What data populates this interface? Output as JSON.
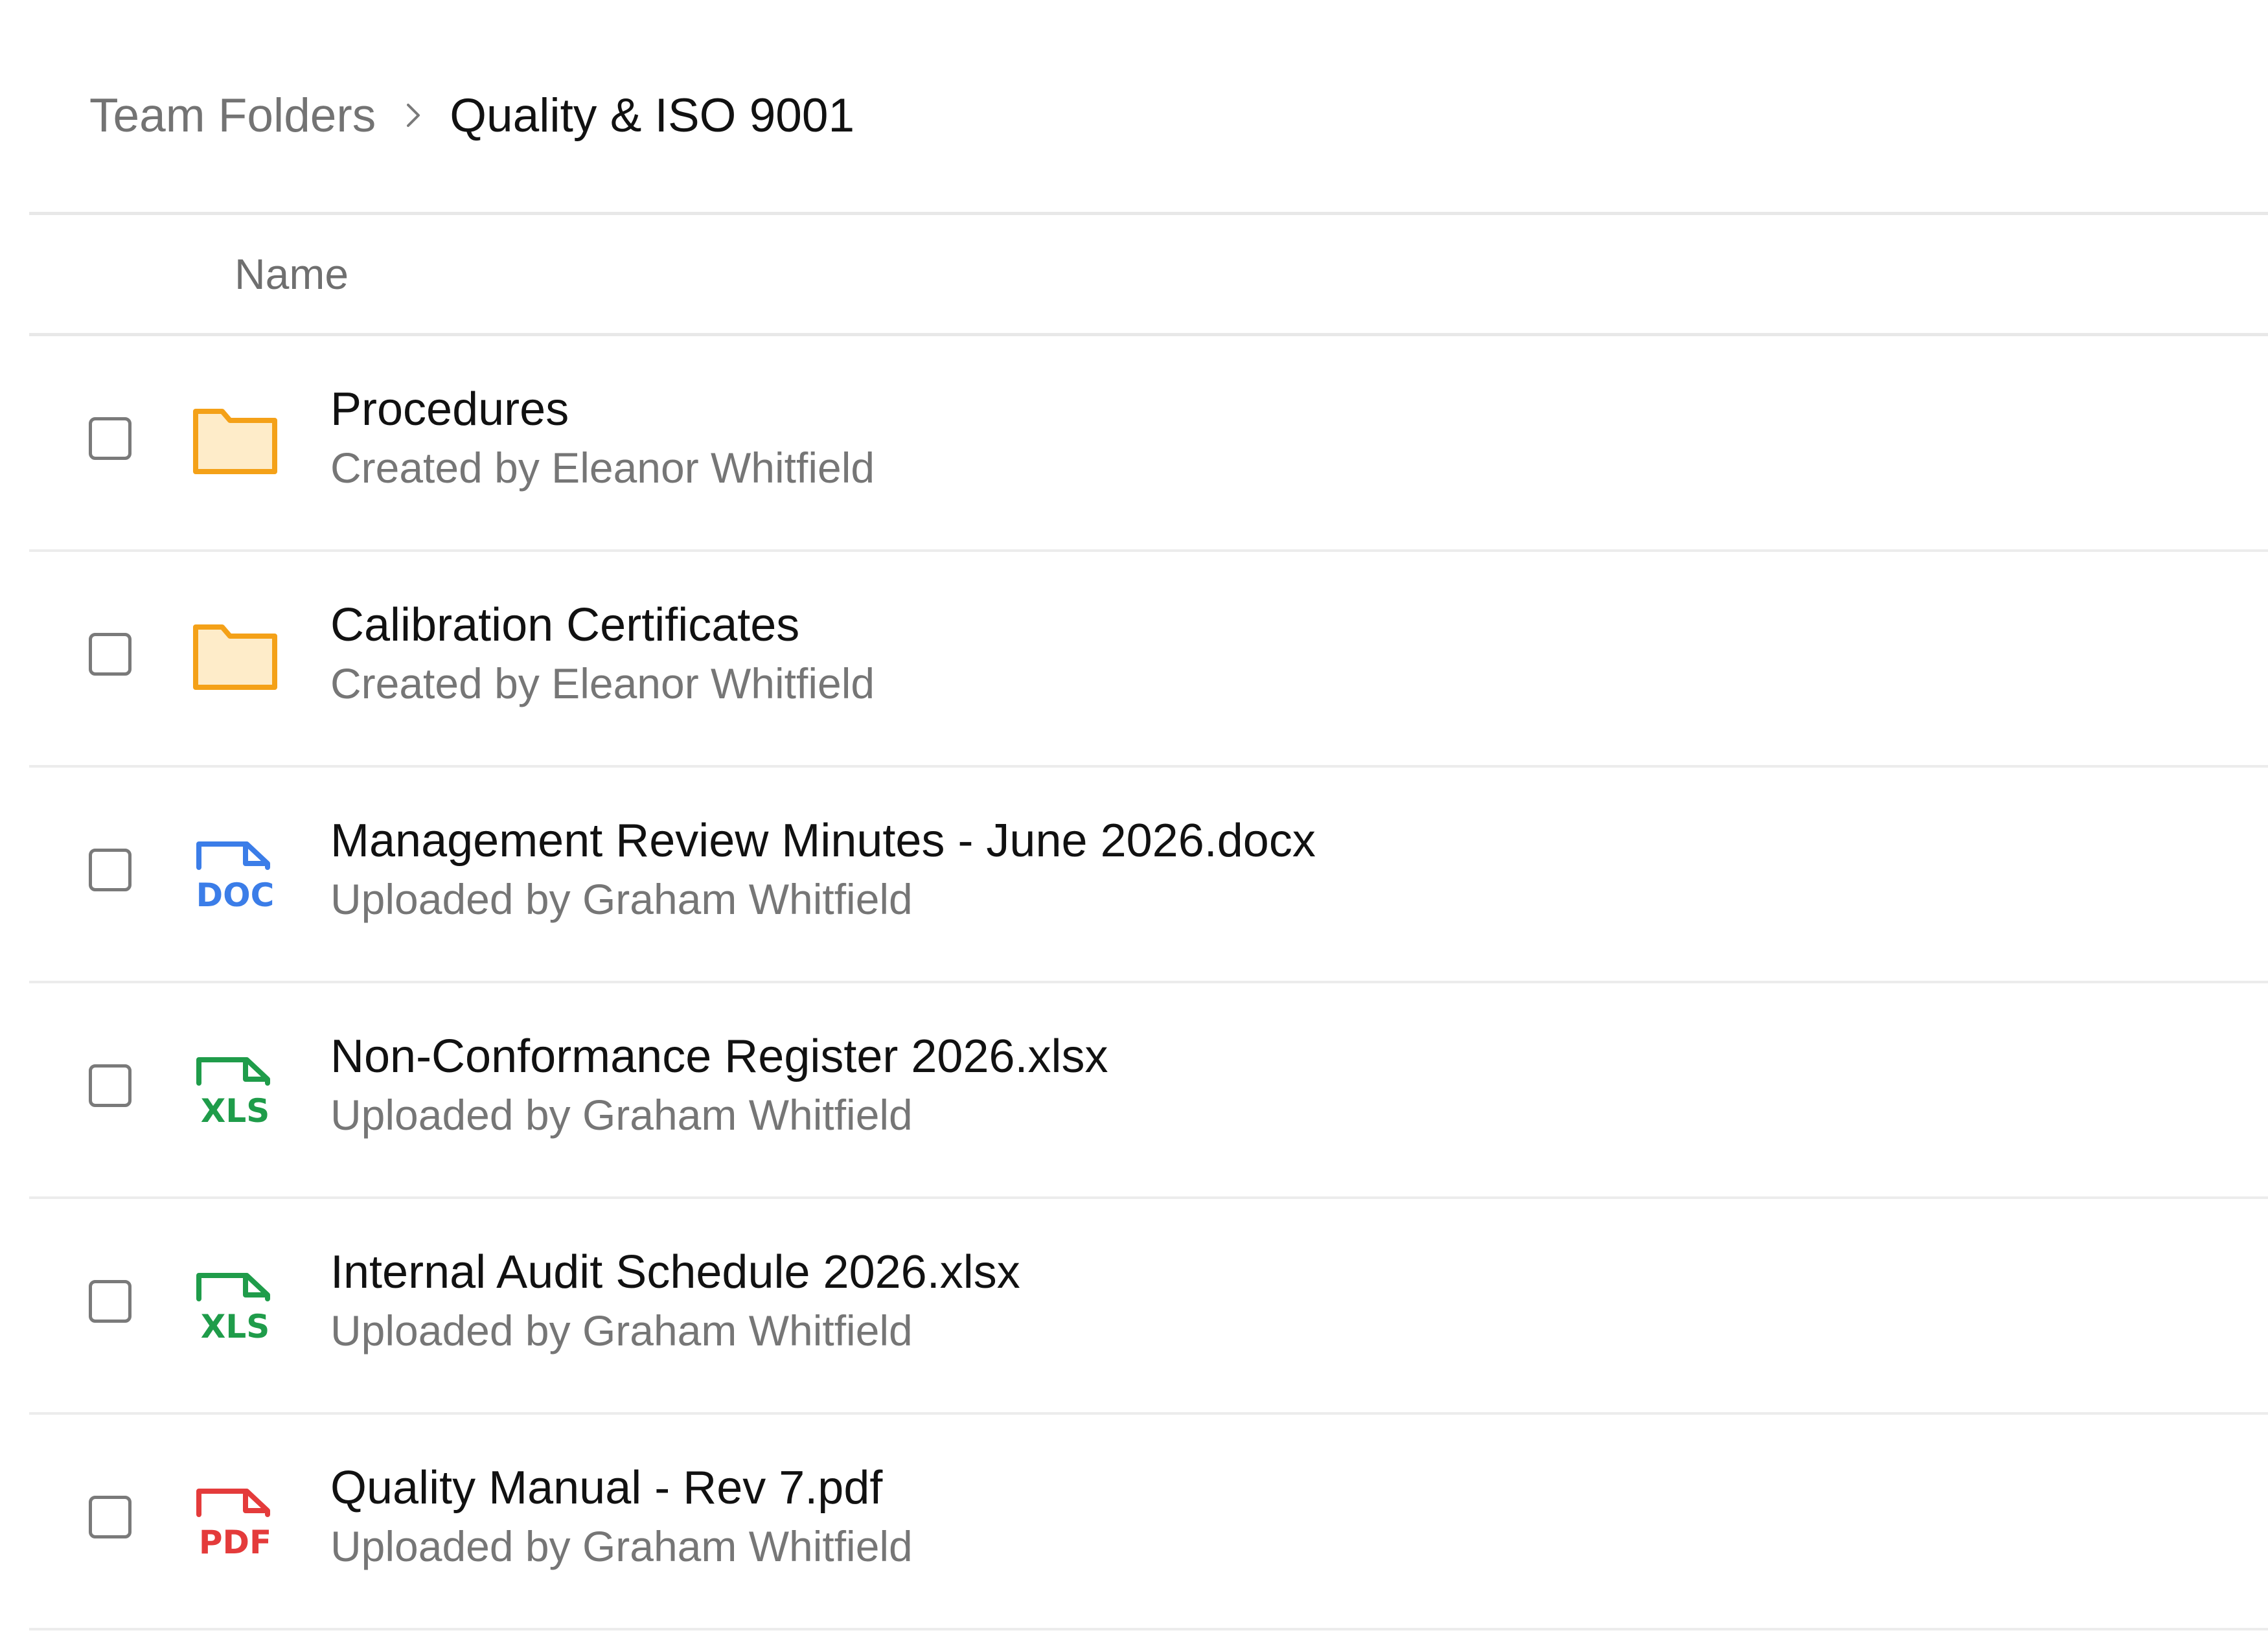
{
  "breadcrumb": {
    "root": "Team Folders",
    "current": "Quality & ISO 9001"
  },
  "table": {
    "name_header": "Name"
  },
  "rows": [
    {
      "type": "folder",
      "title": "Procedures",
      "subtitle": "Created by Eleanor Whitfield"
    },
    {
      "type": "folder",
      "title": "Calibration Certificates",
      "subtitle": "Created by Eleanor Whitfield"
    },
    {
      "type": "doc",
      "title": "Management Review Minutes - June 2026.docx",
      "subtitle": "Uploaded by Graham Whitfield",
      "icon_label": "DOC"
    },
    {
      "type": "xls",
      "title": "Non-Conformance Register 2026.xlsx",
      "subtitle": "Uploaded by Graham Whitfield",
      "icon_label": "XLS"
    },
    {
      "type": "xls",
      "title": "Internal Audit Schedule 2026.xlsx",
      "subtitle": "Uploaded by Graham Whitfield",
      "icon_label": "XLS"
    },
    {
      "type": "pdf",
      "title": "Quality Manual - Rev 7.pdf",
      "subtitle": "Uploaded by Graham Whitfield",
      "icon_label": "PDF"
    }
  ],
  "colors": {
    "folder_stroke": "#f4a118",
    "folder_fill": "#feecc9",
    "doc": "#3b7de8",
    "xls": "#1f9c4a",
    "pdf": "#e43b3b"
  },
  "icons": {
    "breadcrumb_separator": "chevron-right-icon",
    "folder": "folder-icon",
    "doc": "doc-file-icon",
    "xls": "xls-file-icon",
    "pdf": "pdf-file-icon"
  }
}
